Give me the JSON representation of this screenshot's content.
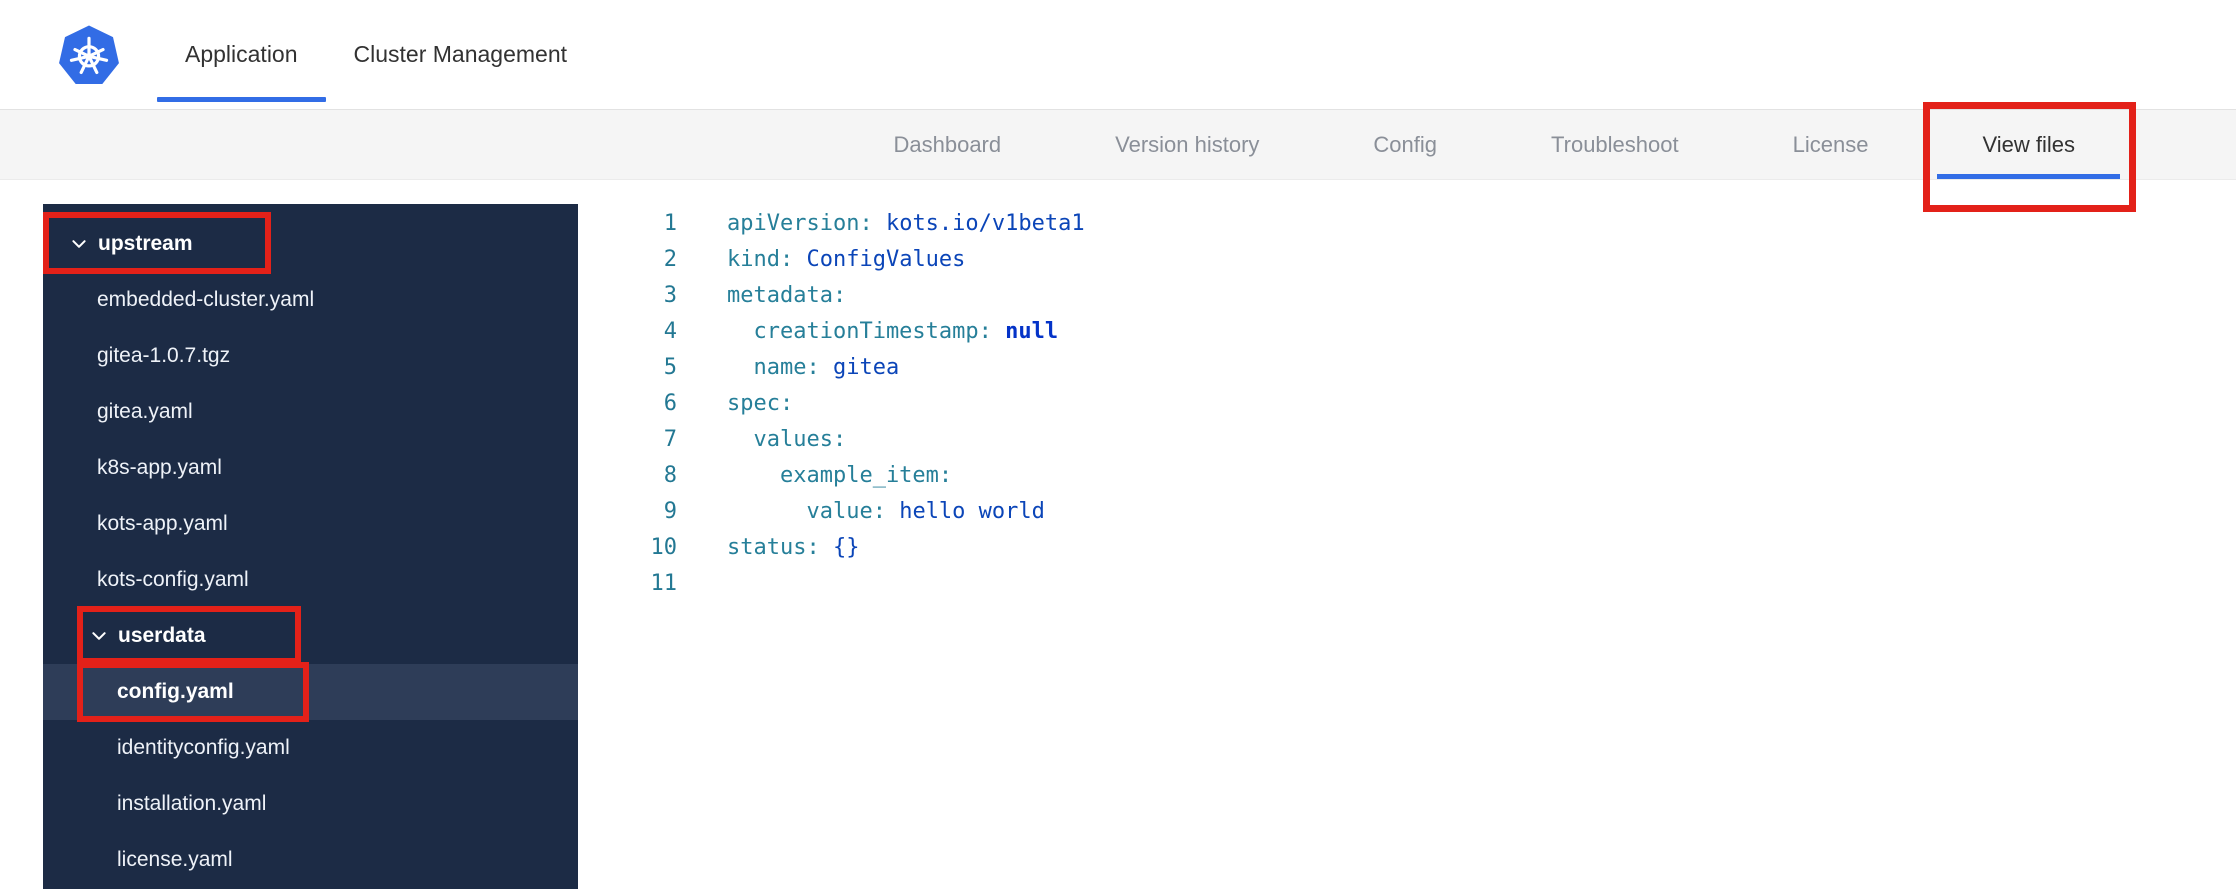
{
  "header": {
    "tabs": [
      {
        "label": "Application",
        "active": true
      },
      {
        "label": "Cluster Management",
        "active": false
      }
    ]
  },
  "subnav": {
    "tabs": [
      {
        "label": "Dashboard",
        "active": false
      },
      {
        "label": "Version history",
        "active": false
      },
      {
        "label": "Config",
        "active": false
      },
      {
        "label": "Troubleshoot",
        "active": false
      },
      {
        "label": "License",
        "active": false
      },
      {
        "label": "View files",
        "active": true,
        "annotated": true
      }
    ]
  },
  "file_tree": {
    "items": [
      {
        "label": "upstream",
        "type": "folder",
        "level": 1,
        "expanded": true,
        "annotated": true
      },
      {
        "label": "embedded-cluster.yaml",
        "type": "file",
        "level": 1
      },
      {
        "label": "gitea-1.0.7.tgz",
        "type": "file",
        "level": 1
      },
      {
        "label": "gitea.yaml",
        "type": "file",
        "level": 1
      },
      {
        "label": "k8s-app.yaml",
        "type": "file",
        "level": 1
      },
      {
        "label": "kots-app.yaml",
        "type": "file",
        "level": 1
      },
      {
        "label": "kots-config.yaml",
        "type": "file",
        "level": 1
      },
      {
        "label": "userdata",
        "type": "folder",
        "level": 2,
        "expanded": true,
        "annotated": true
      },
      {
        "label": "config.yaml",
        "type": "file",
        "level": 2,
        "selected": true,
        "annotated": true
      },
      {
        "label": "identityconfig.yaml",
        "type": "file",
        "level": 2
      },
      {
        "label": "installation.yaml",
        "type": "file",
        "level": 2
      },
      {
        "label": "license.yaml",
        "type": "file",
        "level": 2
      }
    ]
  },
  "editor": {
    "lines": [
      {
        "number": "1",
        "key": "apiVersion:",
        "value": " kots.io/v1beta1"
      },
      {
        "number": "2",
        "key": "kind:",
        "value": " ConfigValues"
      },
      {
        "number": "3",
        "key": "metadata:",
        "value": ""
      },
      {
        "number": "4",
        "key": "  creationTimestamp:",
        "value": " null"
      },
      {
        "number": "5",
        "key": "  name:",
        "value": " gitea"
      },
      {
        "number": "6",
        "key": "spec:",
        "value": ""
      },
      {
        "number": "7",
        "key": "  values:",
        "value": ""
      },
      {
        "number": "8",
        "key": "    example_item:",
        "value": ""
      },
      {
        "number": "9",
        "key": "      value:",
        "value": " hello world"
      },
      {
        "number": "10",
        "key": "status:",
        "value": " {}"
      },
      {
        "number": "11",
        "key": "",
        "value": ""
      }
    ]
  },
  "colors": {
    "accent_blue": "#326de6",
    "annotation_red": "#e32119",
    "sidebar_bg": "#1c2b45",
    "sidebar_selected_bg": "#2e3d58",
    "subnav_bg": "#f5f5f5",
    "code_key": "#267f99",
    "code_value": "#0b45b8",
    "line_number": "#237893"
  },
  "icons": {
    "logo": "kubernetes-logo",
    "tree_expand": "chevron-down-icon"
  }
}
